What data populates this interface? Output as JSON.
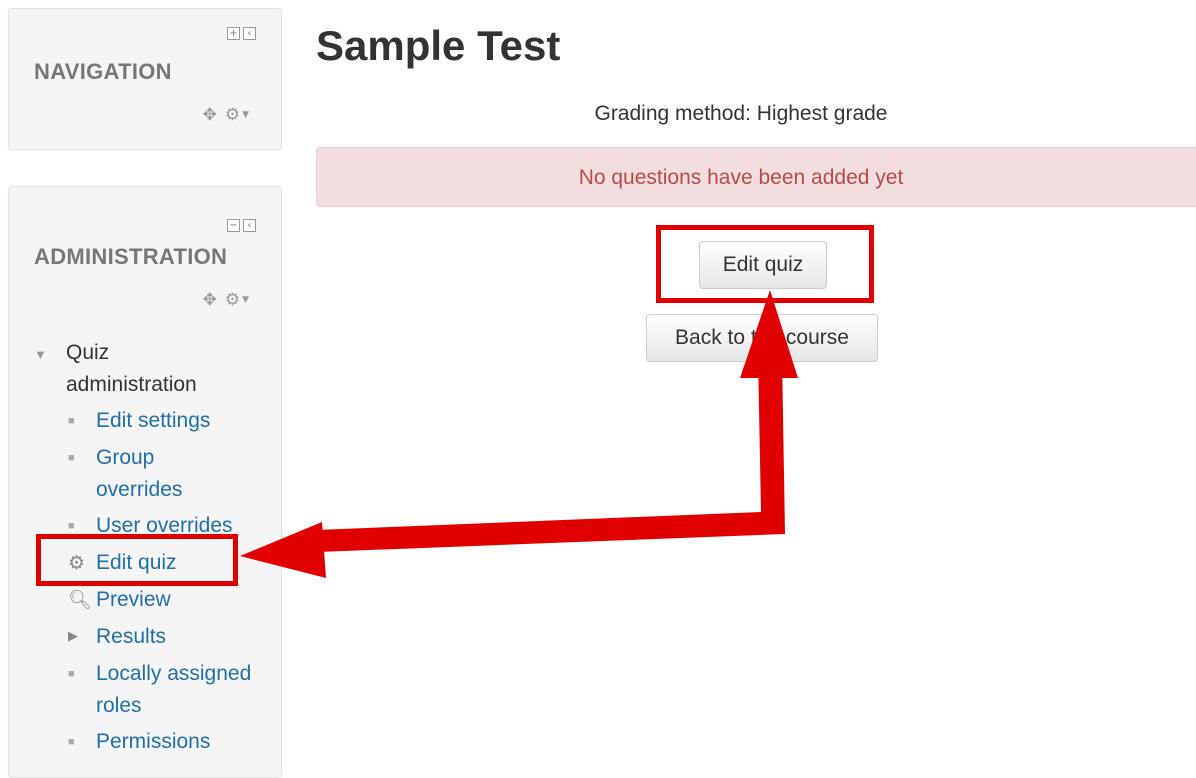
{
  "navigation": {
    "title": "NAVIGATION"
  },
  "administration": {
    "title": "ADMINISTRATION",
    "section_label": "Quiz administration",
    "items": [
      {
        "label": "Edit settings",
        "icon": "bullet"
      },
      {
        "label": "Group overrides",
        "icon": "bullet"
      },
      {
        "label": "User overrides",
        "icon": "bullet"
      },
      {
        "label": "Edit quiz",
        "icon": "gear-icon"
      },
      {
        "label": "Preview",
        "icon": "search-icon"
      },
      {
        "label": "Results",
        "icon": "triangle-right-icon"
      },
      {
        "label": "Locally assigned roles",
        "icon": "bullet"
      },
      {
        "label": "Permissions",
        "icon": "bullet"
      }
    ]
  },
  "main": {
    "title": "Sample Test",
    "grading": "Grading method: Highest grade",
    "alert": "No questions have been added yet",
    "edit_button": "Edit quiz",
    "back_button": "Back to the course"
  },
  "annotation": {
    "color": "#e00000"
  }
}
